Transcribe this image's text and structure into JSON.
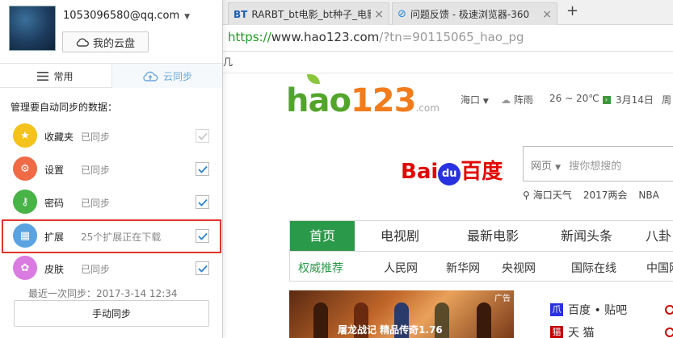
{
  "browser": {
    "tabs": [
      {
        "icon": "BT",
        "title": "RARBT_bt电影_bt种子_电影"
      },
      {
        "icon": "⊘",
        "title": "问题反馈 - 极速浏览器-360"
      }
    ],
    "new_tab_label": "+",
    "url": {
      "scheme": "https://",
      "host": "www.hao123.com",
      "query": "/?tn=90115065_hao_pg"
    },
    "bookmark_fragment": "几"
  },
  "hao123": {
    "logo": {
      "main": "hao",
      "num": "123",
      "suffix": ".com"
    },
    "location": "海口",
    "weather": "阵雨",
    "temp": "26 ~ 20℃",
    "date": "3月14日",
    "weekday": "周",
    "baidu": {
      "left": "Bai",
      "paw": "du",
      "right": "百度"
    },
    "search": {
      "dropdown": "网页",
      "placeholder": "搜你想搜的"
    },
    "hot_words": [
      "海口天气",
      "2017两会",
      "NBA"
    ],
    "nav_tabs": [
      "首页",
      "电视剧",
      "最新电影",
      "新闻头条",
      "八卦"
    ],
    "subnav_lead": "权威推荐",
    "subnav_links": [
      "人民网",
      "新华网",
      "央视网",
      "国际在线",
      "中国网"
    ],
    "game_caption": "屠龙战记 精品传奇1.76",
    "game_tag": "广告",
    "sites": [
      {
        "name": "百度 • 贴吧",
        "color": "#2932e1",
        "glyph": "爪"
      },
      {
        "name": "天 猫",
        "color": "#c40000",
        "glyph": "猫"
      }
    ]
  },
  "panel": {
    "account": "1053096580@qq.com",
    "cloud_button": "我的云盘",
    "tab_common": "常用",
    "tab_sync": "云同步",
    "section_heading": "管理要自动同步的数据：",
    "items": [
      {
        "name": "收藏夹",
        "status": "已同步",
        "color": "#f4c21a",
        "glyph": "★",
        "checked": true,
        "disabled": true
      },
      {
        "name": "设置",
        "status": "已同步",
        "color": "#ef6b46",
        "glyph": "⚙",
        "checked": true,
        "disabled": false
      },
      {
        "name": "密码",
        "status": "已同步",
        "color": "#48b347",
        "glyph": "⚷",
        "checked": true,
        "disabled": false
      },
      {
        "name": "扩展",
        "status": "25个扩展正在下载",
        "color": "#5aa2e0",
        "glyph": "▦",
        "checked": true,
        "disabled": false
      },
      {
        "name": "皮肤",
        "status": "已同步",
        "color": "#d97be0",
        "glyph": "✿",
        "checked": true,
        "disabled": false
      }
    ],
    "last_sync": "最近一次同步：2017-3-14 12:34",
    "manual_sync": "手动同步"
  }
}
